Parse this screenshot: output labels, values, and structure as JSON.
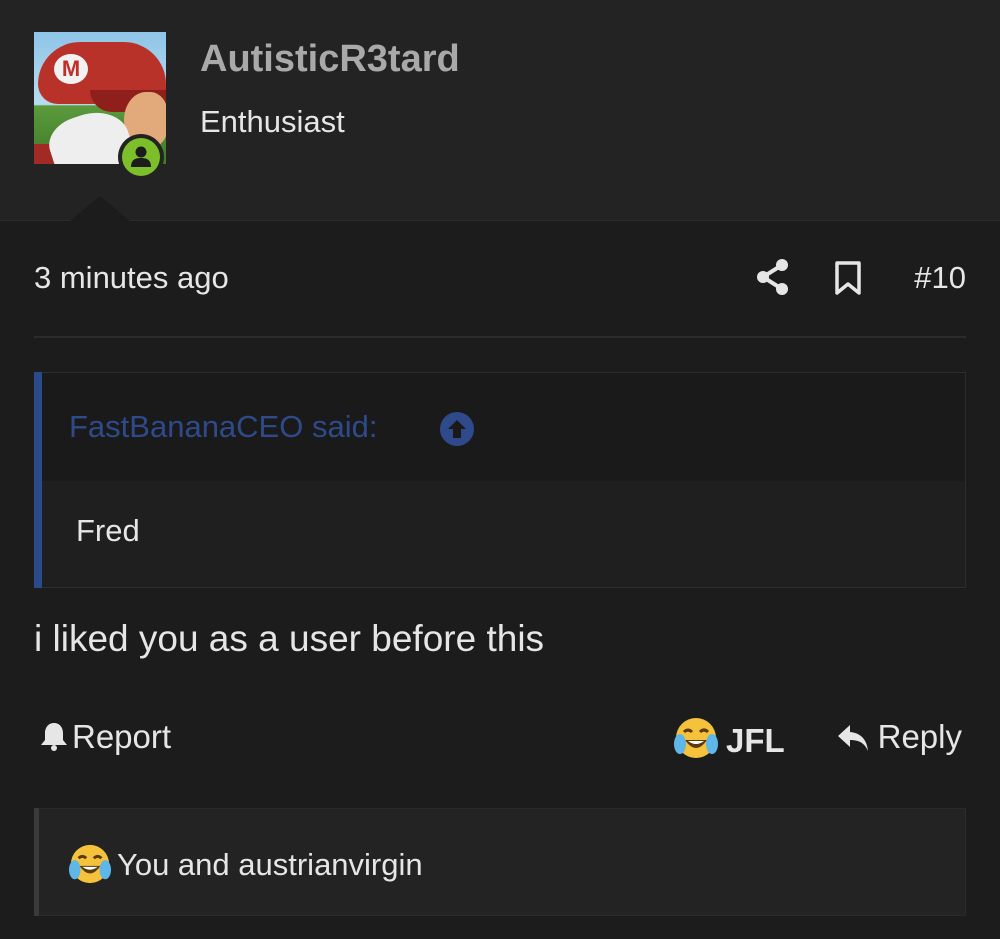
{
  "post": {
    "author": {
      "username": "AutisticR3tard",
      "title": "Enthusiast",
      "avatar_icon": "mario-avatar",
      "status_icon": "online-user-icon",
      "status_color": "#7cbf2a"
    },
    "timestamp": "3 minutes ago",
    "post_number": "#10",
    "quote": {
      "author_label": "FastBananaCEO said:",
      "body": "Fred",
      "accent_color": "#2a4a8a"
    },
    "message": "i liked you as a user before this",
    "actions": {
      "report_label": "Report",
      "reaction_label": "JFL",
      "reply_label": "Reply"
    },
    "reactions_summary": "You and austrianvirgin"
  },
  "colors": {
    "background": "#1c1c1c",
    "header_background": "#232323",
    "username": "#a9a9a9",
    "quote_author": "#2e4a8a"
  }
}
